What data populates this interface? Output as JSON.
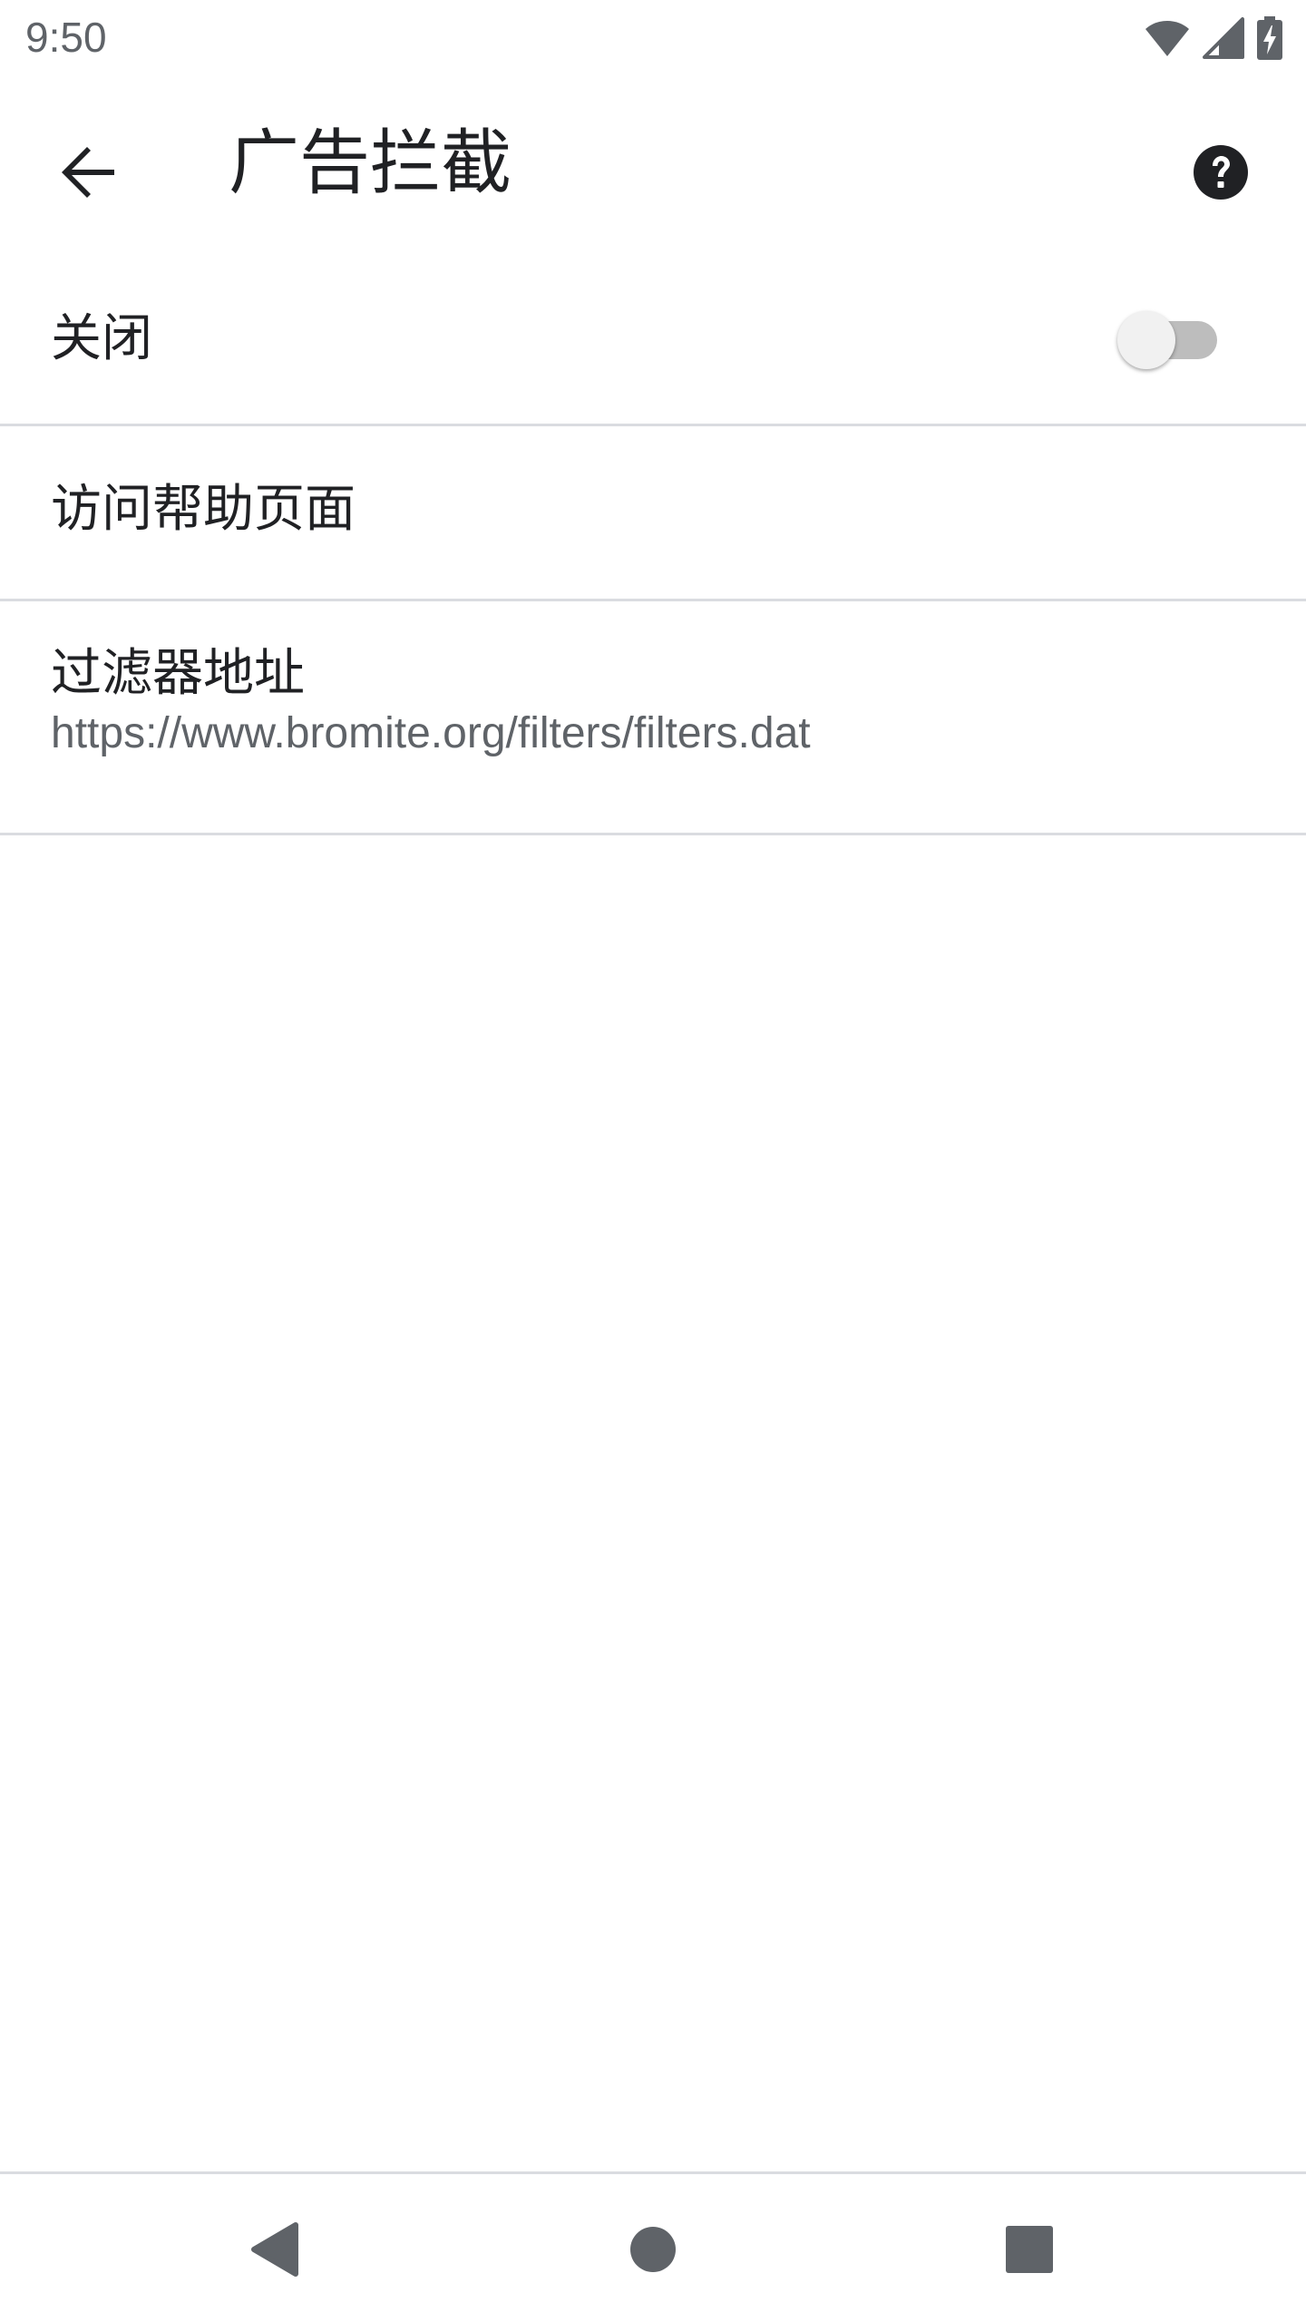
{
  "status_bar": {
    "time": "9:50",
    "icons": [
      "wifi-icon",
      "cell-signal-icon",
      "battery-charging-icon"
    ]
  },
  "app_bar": {
    "title": "广告拦截",
    "back_icon": "arrow-back-icon",
    "help_icon": "help-circle-icon"
  },
  "settings": {
    "toggle": {
      "label": "关闭",
      "checked": false
    },
    "help_page": {
      "label": "访问帮助页面"
    },
    "filter_url": {
      "label": "过滤器地址",
      "value": "https://www.bromite.org/filters/filters.dat"
    }
  },
  "nav_bar": {
    "icons": [
      "nav-back-icon",
      "nav-home-icon",
      "nav-recents-icon"
    ]
  },
  "colors": {
    "text_primary": "#202124",
    "text_secondary": "#5f6368",
    "divider": "#dadce0",
    "switch_track_off": "#bdbdbd",
    "switch_thumb_off": "#f1f1f1"
  }
}
